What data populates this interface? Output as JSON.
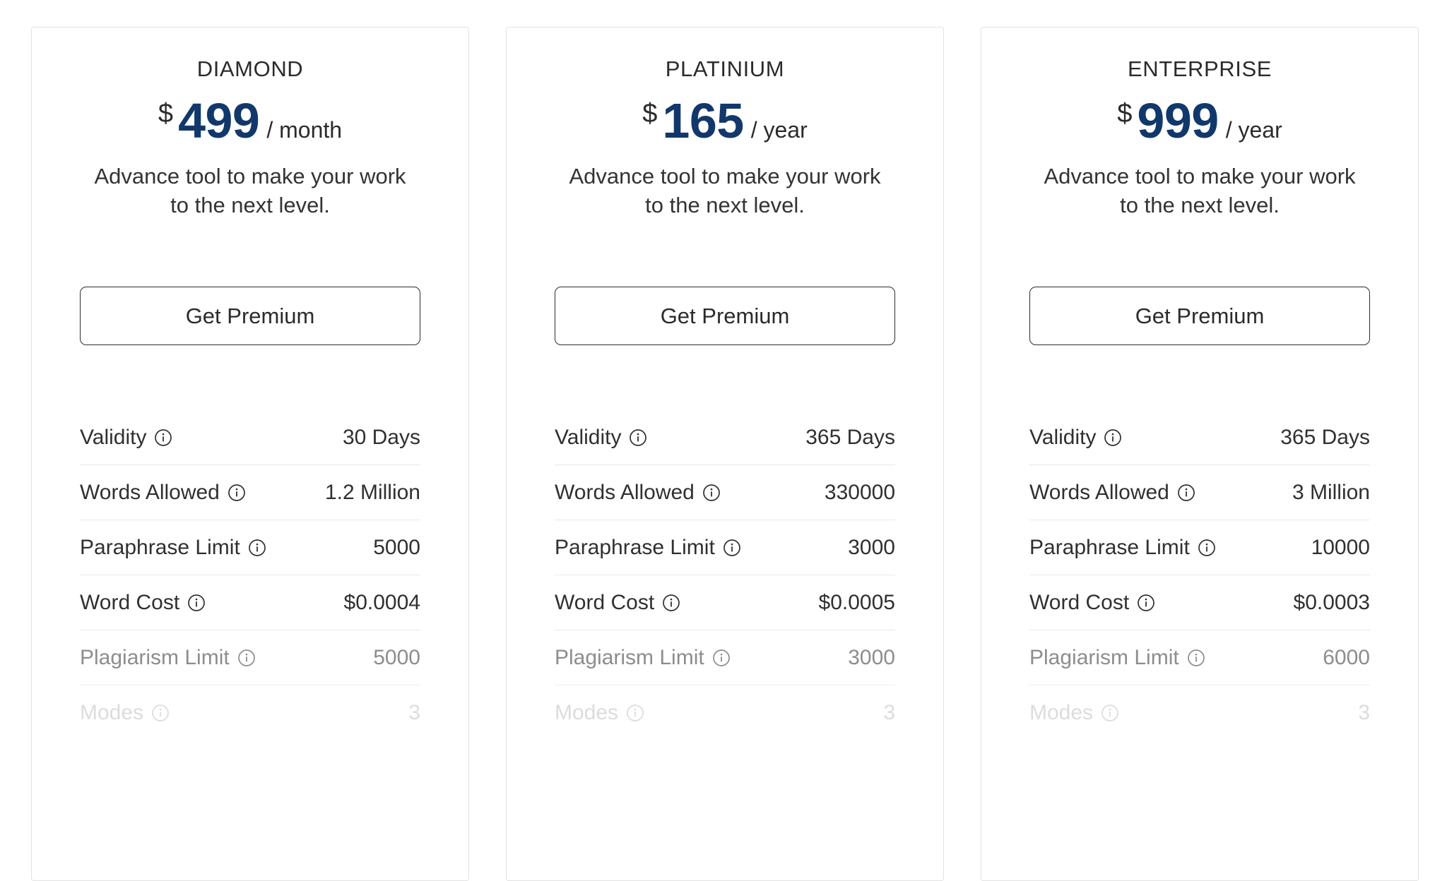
{
  "theme": {
    "price_color": "#12386b",
    "text_color": "#303030",
    "card_border": "#e2e2e2",
    "row_divider": "#e9e9e9",
    "muted_color": "#8d8d8d",
    "faded_color": "#dcdcdc"
  },
  "icons": {
    "info": "info-icon"
  },
  "plans": [
    {
      "title": "DIAMOND",
      "currency": "$",
      "amount": "499",
      "period": "/ month",
      "description": "Advance tool to make your work to the next level.",
      "cta_label": "Get Premium",
      "features": [
        {
          "label": "Validity",
          "value": "30 Days"
        },
        {
          "label": "Words Allowed",
          "value": "1.2 Million"
        },
        {
          "label": "Paraphrase Limit",
          "value": "5000"
        },
        {
          "label": "Word Cost",
          "value": "$0.0004"
        },
        {
          "label": "Plagiarism Limit",
          "value": "5000"
        },
        {
          "label": "Modes",
          "value": "3"
        }
      ]
    },
    {
      "title": "PLATINIUM",
      "currency": "$",
      "amount": "165",
      "period": "/ year",
      "description": "Advance tool to make your work to the next level.",
      "cta_label": "Get Premium",
      "features": [
        {
          "label": "Validity",
          "value": "365 Days"
        },
        {
          "label": "Words Allowed",
          "value": "330000"
        },
        {
          "label": "Paraphrase Limit",
          "value": "3000"
        },
        {
          "label": "Word Cost",
          "value": "$0.0005"
        },
        {
          "label": "Plagiarism Limit",
          "value": "3000"
        },
        {
          "label": "Modes",
          "value": "3"
        }
      ]
    },
    {
      "title": "ENTERPRISE",
      "currency": "$",
      "amount": "999",
      "period": "/ year",
      "description": "Advance tool to make your work to the next level.",
      "cta_label": "Get Premium",
      "features": [
        {
          "label": "Validity",
          "value": "365 Days"
        },
        {
          "label": "Words Allowed",
          "value": "3 Million"
        },
        {
          "label": "Paraphrase Limit",
          "value": "10000"
        },
        {
          "label": "Word Cost",
          "value": "$0.0003"
        },
        {
          "label": "Plagiarism Limit",
          "value": "6000"
        },
        {
          "label": "Modes",
          "value": "3"
        }
      ]
    }
  ]
}
